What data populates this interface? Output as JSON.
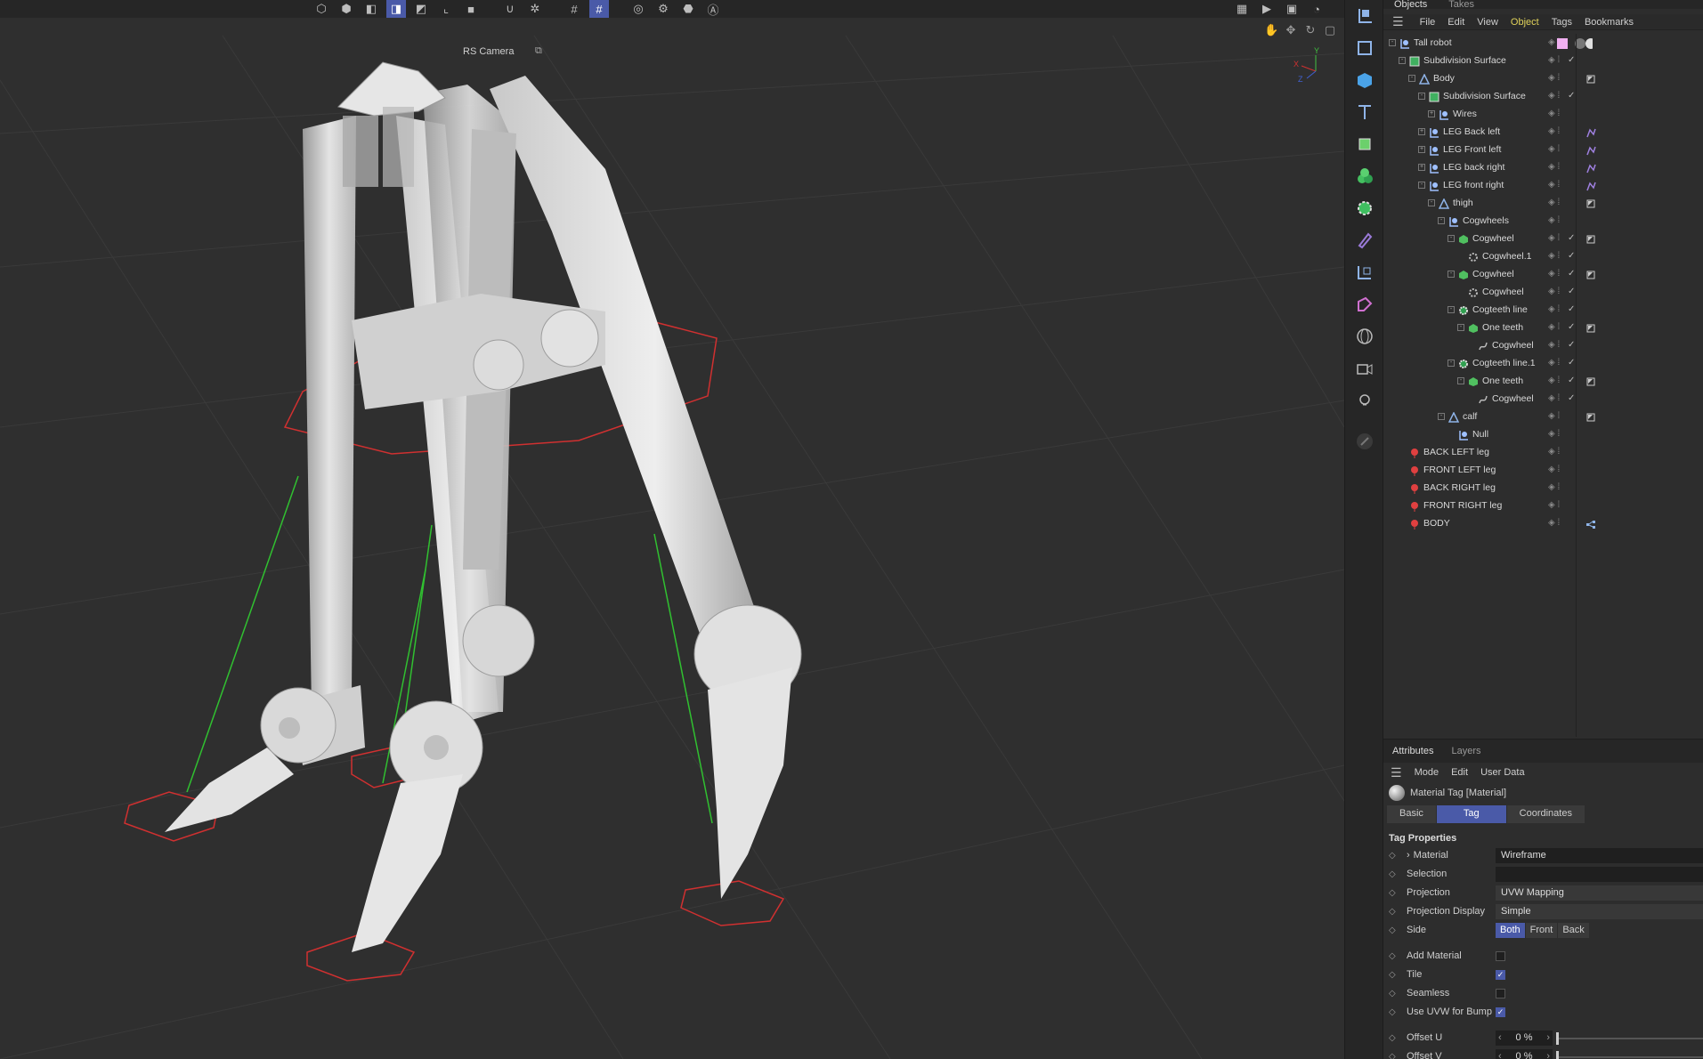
{
  "viewport": {
    "camera_label": "RS Camera",
    "camera_icon": "camera-link-icon",
    "toolbar_icons": [
      "points-mode-icon",
      "edges-mode-icon",
      "polygons-mode-icon",
      "model-mode-icon",
      "object-mode-icon",
      "axis-mode-icon",
      "disabled-icon",
      "magnet-icon",
      "settings-gear-icon",
      "grid-icon",
      "snap-grid-icon",
      "record-icon",
      "render-settings-icon",
      "hex-icon",
      "ai-icon"
    ],
    "nav_icons": [
      "pan-icon",
      "move-icon",
      "rotate-icon",
      "maximize-icon"
    ]
  },
  "tools": [
    "live-selection-icon",
    "box-icon",
    "cube-icon",
    "text-icon",
    "subdivision-icon",
    "mograph-icon",
    "gear-generator-icon",
    "deformer-icon",
    "field-icon",
    "spline-icon",
    "sky-icon",
    "camera-icon",
    "light-icon",
    "sculpt-icon"
  ],
  "objects": {
    "tabs": [
      "Objects",
      "Takes"
    ],
    "menu": [
      "File",
      "Edit",
      "View",
      "Object",
      "Tags",
      "Bookmarks"
    ],
    "rows": [
      {
        "label": "Tall robot",
        "depth": 0,
        "icon": "null-icon",
        "exp": "-",
        "tag": "material-swatch",
        "check": ""
      },
      {
        "label": "Subdivision Surface",
        "depth": 1,
        "icon": "subdivision-icon",
        "exp": "-",
        "tag": "",
        "check": "✓"
      },
      {
        "label": "Body",
        "depth": 2,
        "icon": "joint-icon",
        "exp": "-",
        "tag": "flag",
        "check": ""
      },
      {
        "label": "Subdivision Surface",
        "depth": 3,
        "icon": "subdivision-icon",
        "exp": "-",
        "tag": "",
        "check": "✓"
      },
      {
        "label": "Wires",
        "depth": 4,
        "icon": "null-icon",
        "exp": "+",
        "tag": "",
        "check": ""
      },
      {
        "label": "LEG Back left",
        "depth": 3,
        "icon": "null-icon",
        "exp": "+",
        "tag": "ik",
        "check": ""
      },
      {
        "label": "LEG Front left",
        "depth": 3,
        "icon": "null-icon",
        "exp": "+",
        "tag": "ik",
        "check": ""
      },
      {
        "label": "LEG back  right",
        "depth": 3,
        "icon": "null-icon",
        "exp": "+",
        "tag": "ik",
        "check": ""
      },
      {
        "label": "LEG front right",
        "depth": 3,
        "icon": "null-icon",
        "exp": "-",
        "tag": "ik",
        "check": ""
      },
      {
        "label": "thigh",
        "depth": 4,
        "icon": "joint-icon",
        "exp": "-",
        "tag": "flag",
        "check": ""
      },
      {
        "label": "Cogwheels",
        "depth": 5,
        "icon": "null-icon",
        "exp": "-",
        "tag": "",
        "check": ""
      },
      {
        "label": "Cogwheel",
        "depth": 6,
        "icon": "extrude-icon",
        "exp": "-",
        "tag": "flag",
        "check": "✓"
      },
      {
        "label": "Cogwheel.1",
        "depth": 7,
        "icon": "cog-spline-icon",
        "exp": "",
        "tag": "",
        "check": "✓"
      },
      {
        "label": "Cogwheel",
        "depth": 6,
        "icon": "extrude-icon",
        "exp": "-",
        "tag": "flag",
        "check": "✓"
      },
      {
        "label": "Cogwheel",
        "depth": 7,
        "icon": "cog-spline-icon",
        "exp": "",
        "tag": "",
        "check": "✓"
      },
      {
        "label": "Cogteeth line",
        "depth": 6,
        "icon": "cloner-icon",
        "exp": "-",
        "tag": "",
        "check": "✓"
      },
      {
        "label": "One teeth",
        "depth": 7,
        "icon": "extrude-icon",
        "exp": "-",
        "tag": "flag",
        "check": "✓"
      },
      {
        "label": "Cogwheel",
        "depth": 8,
        "icon": "spline-icon",
        "exp": "",
        "tag": "",
        "check": "✓"
      },
      {
        "label": "Cogteeth line.1",
        "depth": 6,
        "icon": "cloner-icon",
        "exp": "-",
        "tag": "",
        "check": "✓"
      },
      {
        "label": "One teeth",
        "depth": 7,
        "icon": "extrude-icon",
        "exp": "-",
        "tag": "flag",
        "check": "✓"
      },
      {
        "label": "Cogwheel",
        "depth": 8,
        "icon": "spline-icon",
        "exp": "",
        "tag": "",
        "check": "✓"
      },
      {
        "label": "calf",
        "depth": 5,
        "icon": "joint-icon",
        "exp": "-",
        "tag": "flag",
        "check": ""
      },
      {
        "label": "Null",
        "depth": 6,
        "icon": "null-icon",
        "exp": "",
        "tag": "",
        "check": ""
      },
      {
        "label": "BACK LEFT leg",
        "depth": 1,
        "icon": "red-null-icon",
        "exp": "",
        "tag": "",
        "check": ""
      },
      {
        "label": "FRONT LEFT leg",
        "depth": 1,
        "icon": "red-null-icon",
        "exp": "",
        "tag": "",
        "check": ""
      },
      {
        "label": "BACK RIGHT leg",
        "depth": 1,
        "icon": "red-null-icon",
        "exp": "",
        "tag": "",
        "check": ""
      },
      {
        "label": "FRONT RIGHT leg",
        "depth": 1,
        "icon": "red-null-icon",
        "exp": "",
        "tag": "",
        "check": ""
      },
      {
        "label": "BODY",
        "depth": 1,
        "icon": "red-null-icon",
        "exp": "",
        "tag": "constraint",
        "check": ""
      }
    ]
  },
  "attributes": {
    "tabs": [
      "Attributes",
      "Layers"
    ],
    "menu": [
      "Mode",
      "Edit",
      "User Data"
    ],
    "title": "Material Tag [Material]",
    "sub_tabs": [
      "Basic",
      "Tag",
      "Coordinates"
    ],
    "section": "Tag Properties",
    "material": {
      "name": "Material",
      "value": "Wireframe"
    },
    "selection": {
      "name": "Selection",
      "value": ""
    },
    "projection": {
      "name": "Projection",
      "value": "UVW Mapping"
    },
    "projection_display": {
      "name": "Projection Display",
      "value": "Simple"
    },
    "side": {
      "name": "Side",
      "options": [
        "Both",
        "Front",
        "Back"
      ]
    },
    "add_material": {
      "name": "Add Material",
      "checked": false
    },
    "tile": {
      "name": "Tile",
      "checked": true
    },
    "seamless": {
      "name": "Seamless",
      "checked": false
    },
    "use_uvw": {
      "name": "Use UVW for Bump",
      "checked": true
    },
    "offset_u": {
      "name": "Offset U",
      "value": "0 %"
    },
    "offset_v": {
      "name": "Offset V",
      "value": "0 %"
    }
  },
  "colors": {
    "accent": "#4a5aa8",
    "highlight_menu": "#e0d25a",
    "helper_red": "#d03030",
    "ik_green": "#30c030"
  }
}
